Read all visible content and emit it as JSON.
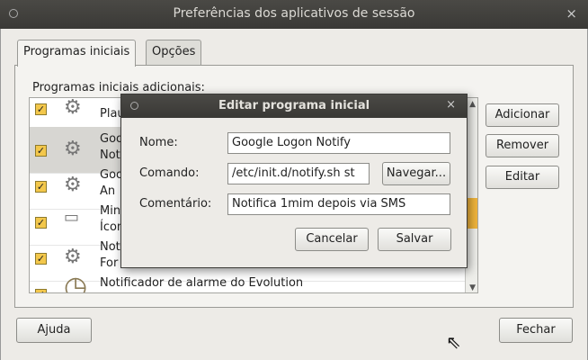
{
  "window": {
    "title": "Preferências dos aplicativos de sessão",
    "close_glyph": "×"
  },
  "tabs": [
    {
      "label": "Programas iniciais",
      "active": true
    },
    {
      "label": "Opções",
      "active": false
    }
  ],
  "startup": {
    "section_label": "Programas iniciais adicionais:",
    "rows": [
      {
        "checked": true,
        "icon": "gear-icon",
        "line1": "",
        "line2": "Plau"
      },
      {
        "checked": true,
        "icon": "gear-icon",
        "line1": "Goo",
        "line2": "Noti"
      },
      {
        "checked": true,
        "icon": "gear-icon",
        "line1": "Goo",
        "line2": "An"
      },
      {
        "checked": true,
        "icon": "drive-icon",
        "line1": "Min",
        "line2": "Ícon"
      },
      {
        "checked": true,
        "icon": "gear-icon",
        "line1": "Not",
        "line2": "For"
      },
      {
        "checked": true,
        "icon": "clock-icon",
        "line1": "Notificador de alarme do Evolution",
        "line2": ""
      }
    ],
    "buttons": {
      "add": "Adicionar",
      "remove": "Remover",
      "edit": "Editar"
    }
  },
  "footer": {
    "help": "Ajuda",
    "close": "Fechar"
  },
  "dialog": {
    "title": "Editar programa inicial",
    "close_glyph": "×",
    "name_label": "Nome:",
    "name_value": "Google Logon Notify",
    "command_label": "Comando:",
    "command_value": "/etc/init.d/notify.sh st",
    "browse": "Navegar...",
    "comment_label": "Comentário:",
    "comment_value": "Notifica 1mim depois via SMS",
    "cancel": "Cancelar",
    "save": "Salvar"
  }
}
